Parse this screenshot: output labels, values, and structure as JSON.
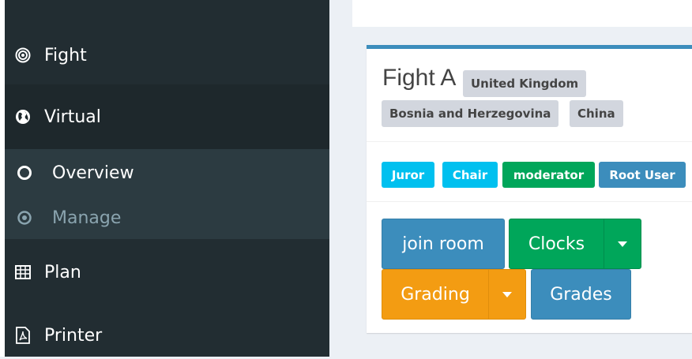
{
  "sidebar": {
    "items": [
      {
        "label": "Fight",
        "icon": "target-icon"
      },
      {
        "label": "Virtual",
        "icon": "globe-icon"
      },
      {
        "label": "Plan",
        "icon": "table-icon"
      },
      {
        "label": "Printer",
        "icon": "pdf-file-icon"
      }
    ],
    "subitems": [
      {
        "label": "Overview",
        "icon": "circle-outline-icon"
      },
      {
        "label": "Manage",
        "icon": "dot-circle-icon"
      }
    ]
  },
  "fight": {
    "title": "Fight A",
    "countries": [
      "United Kingdom",
      "Bosnia and Herzegovina",
      "China"
    ],
    "roles": [
      {
        "label": "Juror",
        "color": "#00c0ef"
      },
      {
        "label": "Chair",
        "color": "#00c0ef"
      },
      {
        "label": "moderator",
        "color": "#00a65a"
      },
      {
        "label": "Root User",
        "color": "#3c8dbc"
      }
    ],
    "buttons": {
      "join": "join room",
      "clocks": "Clocks",
      "grading": "Grading",
      "grades": "Grades"
    }
  },
  "colors": {
    "sidebar_bg": "#222d32",
    "primary": "#3c8dbc",
    "success": "#00a65a",
    "warning": "#f39c12",
    "info": "#00c0ef"
  }
}
